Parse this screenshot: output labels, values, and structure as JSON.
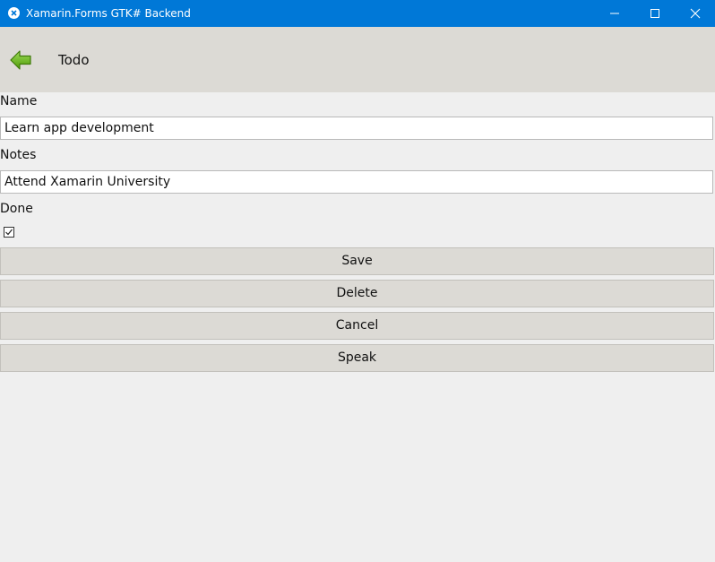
{
  "window": {
    "title": "Xamarin.Forms GTK# Backend",
    "accent_color": "#0078d7",
    "controls": [
      "minimize-icon",
      "maximize-icon",
      "close-icon"
    ]
  },
  "navbar": {
    "back_icon": "back-arrow-icon",
    "title": "Todo"
  },
  "form": {
    "name_label": "Name",
    "name_value": "Learn app development",
    "notes_label": "Notes",
    "notes_value": "Attend Xamarin University",
    "done_label": "Done",
    "done_checked": true
  },
  "buttons": {
    "save": "Save",
    "delete": "Delete",
    "cancel": "Cancel",
    "speak": "Speak"
  }
}
